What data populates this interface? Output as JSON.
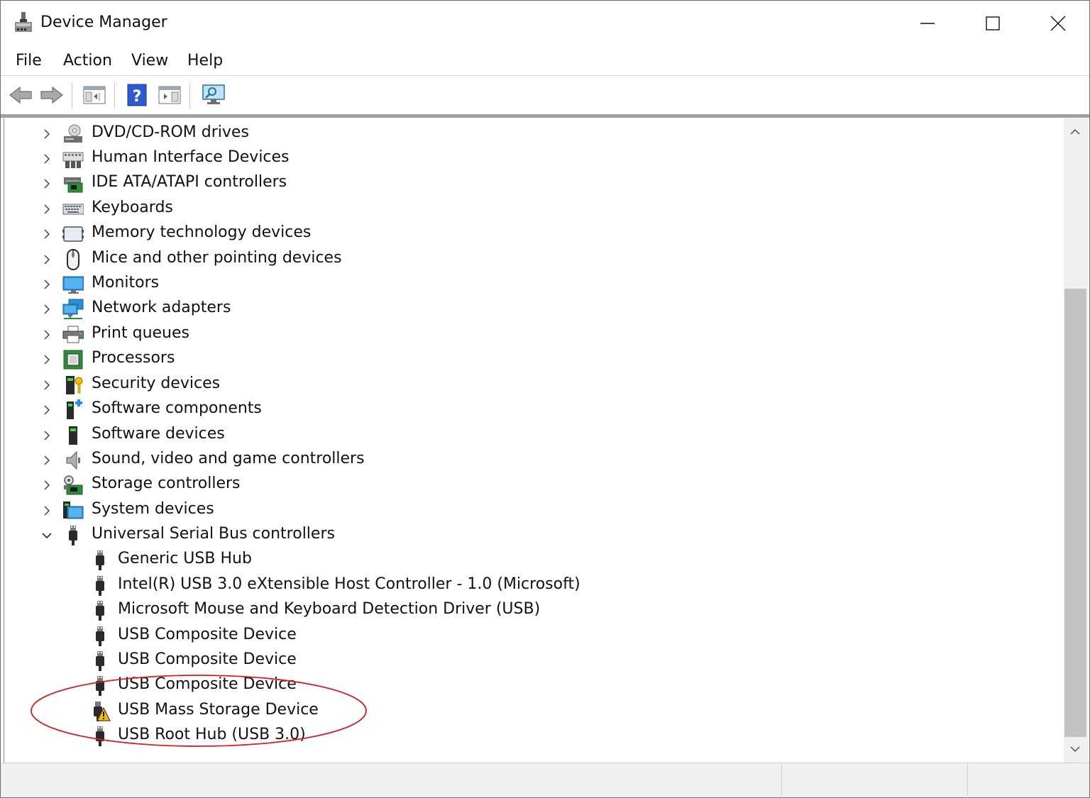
{
  "window": {
    "title": "Device Manager"
  },
  "menu": [
    "File",
    "Action",
    "View",
    "Help"
  ],
  "toolbar": [
    "back",
    "forward",
    "show-hide-console-tree",
    "help",
    "show-hide-action-pane",
    "scan-for-hardware-changes"
  ],
  "tree": {
    "categories": [
      {
        "label": "DVD/CD-ROM drives",
        "icon": "dvd-drive-icon"
      },
      {
        "label": "Human Interface Devices",
        "icon": "hid-icon"
      },
      {
        "label": "IDE ATA/ATAPI controllers",
        "icon": "ide-controller-icon"
      },
      {
        "label": "Keyboards",
        "icon": "keyboard-icon"
      },
      {
        "label": "Memory technology devices",
        "icon": "memory-device-icon"
      },
      {
        "label": "Mice and other pointing devices",
        "icon": "mouse-icon"
      },
      {
        "label": "Monitors",
        "icon": "monitor-icon"
      },
      {
        "label": "Network adapters",
        "icon": "network-adapter-icon"
      },
      {
        "label": "Print queues",
        "icon": "printer-icon"
      },
      {
        "label": "Processors",
        "icon": "processor-icon"
      },
      {
        "label": "Security devices",
        "icon": "security-device-icon"
      },
      {
        "label": "Software components",
        "icon": "software-component-icon"
      },
      {
        "label": "Software devices",
        "icon": "software-device-icon"
      },
      {
        "label": "Sound, video and game controllers",
        "icon": "sound-icon"
      },
      {
        "label": "Storage controllers",
        "icon": "storage-controller-icon"
      },
      {
        "label": "System devices",
        "icon": "system-devices-icon"
      }
    ],
    "expanded": {
      "label": "Universal Serial Bus controllers",
      "icon": "usb-plug-icon",
      "children": [
        {
          "label": "Generic USB Hub",
          "warning": false
        },
        {
          "label": "Intel(R) USB 3.0 eXtensible Host Controller - 1.0 (Microsoft)",
          "warning": false
        },
        {
          "label": "Microsoft Mouse and Keyboard Detection Driver (USB)",
          "warning": false
        },
        {
          "label": "USB Composite Device",
          "warning": false
        },
        {
          "label": "USB Composite Device",
          "warning": false
        },
        {
          "label": "USB Composite Device",
          "warning": false
        },
        {
          "label": "USB Mass Storage Device",
          "warning": true
        },
        {
          "label": "USB Root Hub (USB 3.0)",
          "warning": false
        }
      ]
    }
  },
  "annotation": {
    "shape": "ellipse",
    "color": "#d42020",
    "highlights": "USB Mass Storage Device"
  },
  "colors": {
    "warning": "#f0c000",
    "monitor_blue": "#2b8fd6",
    "annotation": "#d42020"
  }
}
